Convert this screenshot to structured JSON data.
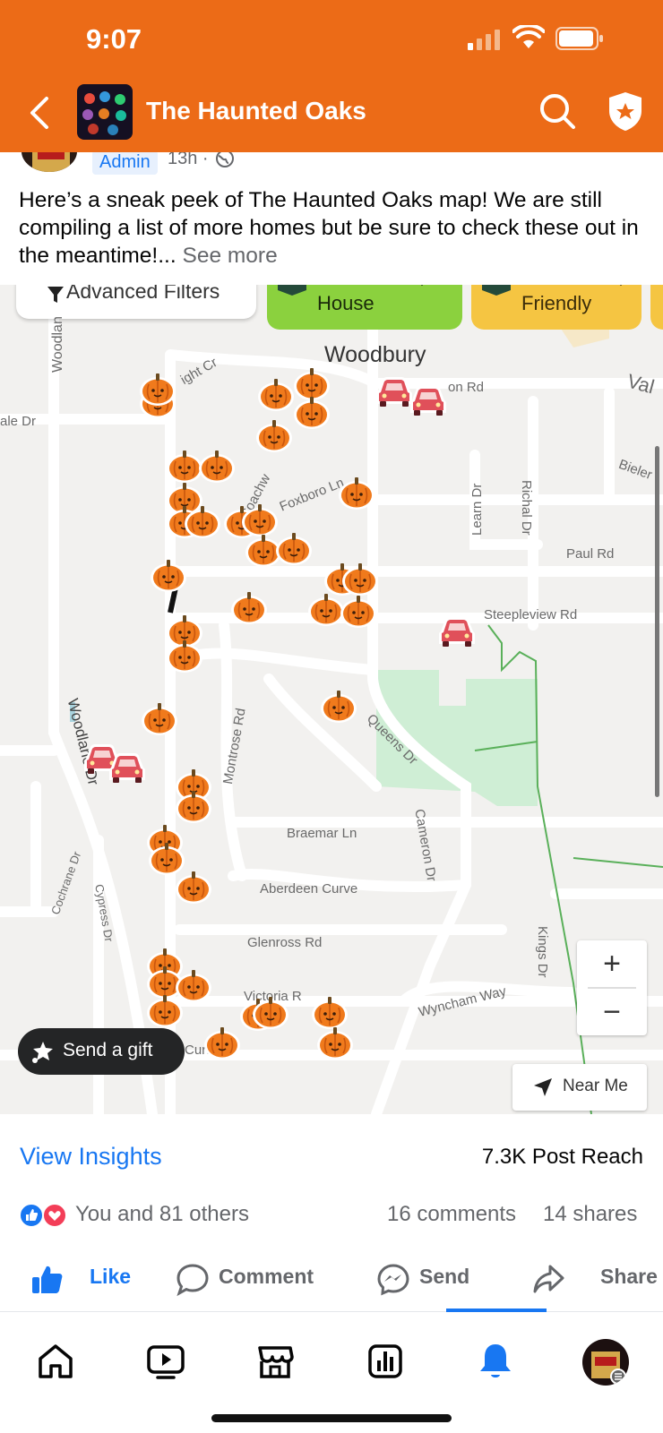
{
  "status_bar": {
    "time": "9:07"
  },
  "header": {
    "title": "The Haunted Oaks"
  },
  "post": {
    "admin_badge": "Admin",
    "time": "13h ·",
    "text": "Here’s a sneak peek of The Haunted Oaks map! We are still compiling a list of more homes but be sure to check these out in the meantime!...",
    "see_more": "See more"
  },
  "map": {
    "chips": {
      "filters": "Advanced Filters",
      "house": "House",
      "friendly": "Friendly"
    },
    "place_label": "Woodbury",
    "street_labels": {
      "woodlane_top": "Woodlan",
      "dale": "ale Dr",
      "knight": "ight Cr",
      "coachway": "Coachw",
      "foxboro": "Foxboro Ln",
      "woodbury_rd": "on Rd",
      "val": "Val",
      "bieler": "Bieler",
      "learn": "Learn Dr",
      "richal": "Richal Dr",
      "paul": "Paul Rd",
      "steepleview": "Steepleview Rd",
      "queens": "Queens Dr",
      "montrose": "Montrose Rd",
      "woodlane": "Woodlane Dr",
      "braemar": "Braemar Ln",
      "cameron": "Cameron Dr",
      "aberdeen": "Aberdeen Curve",
      "cochrane": "Cochrane Dr",
      "cypress": "Cypress Dr",
      "glenross": "Glenross Rd",
      "kings": "Kings Dr",
      "victoria": "Victoria R",
      "wyncham": "Wyncham Way",
      "court": "Curt"
    },
    "zoom_in": "+",
    "zoom_out": "−",
    "near_me": "Near Me",
    "send_gift": "Send a gift"
  },
  "insights": {
    "view_label": "View Insights",
    "reach": "7.3K Post Reach"
  },
  "reactions": {
    "text": "You and 81 others",
    "comments": "16 comments",
    "shares": "14 shares"
  },
  "actions": {
    "like": "Like",
    "comment": "Comment",
    "send": "Send",
    "share": "Share"
  },
  "tabs": [
    "home-icon",
    "video-icon",
    "marketplace-icon",
    "insights-icon",
    "bell-icon",
    "profile-avatar"
  ],
  "colors": {
    "header": "#ec6b17",
    "accent": "#1877f2",
    "pumpkin": "#f07a1c",
    "car": "#e0505a"
  }
}
